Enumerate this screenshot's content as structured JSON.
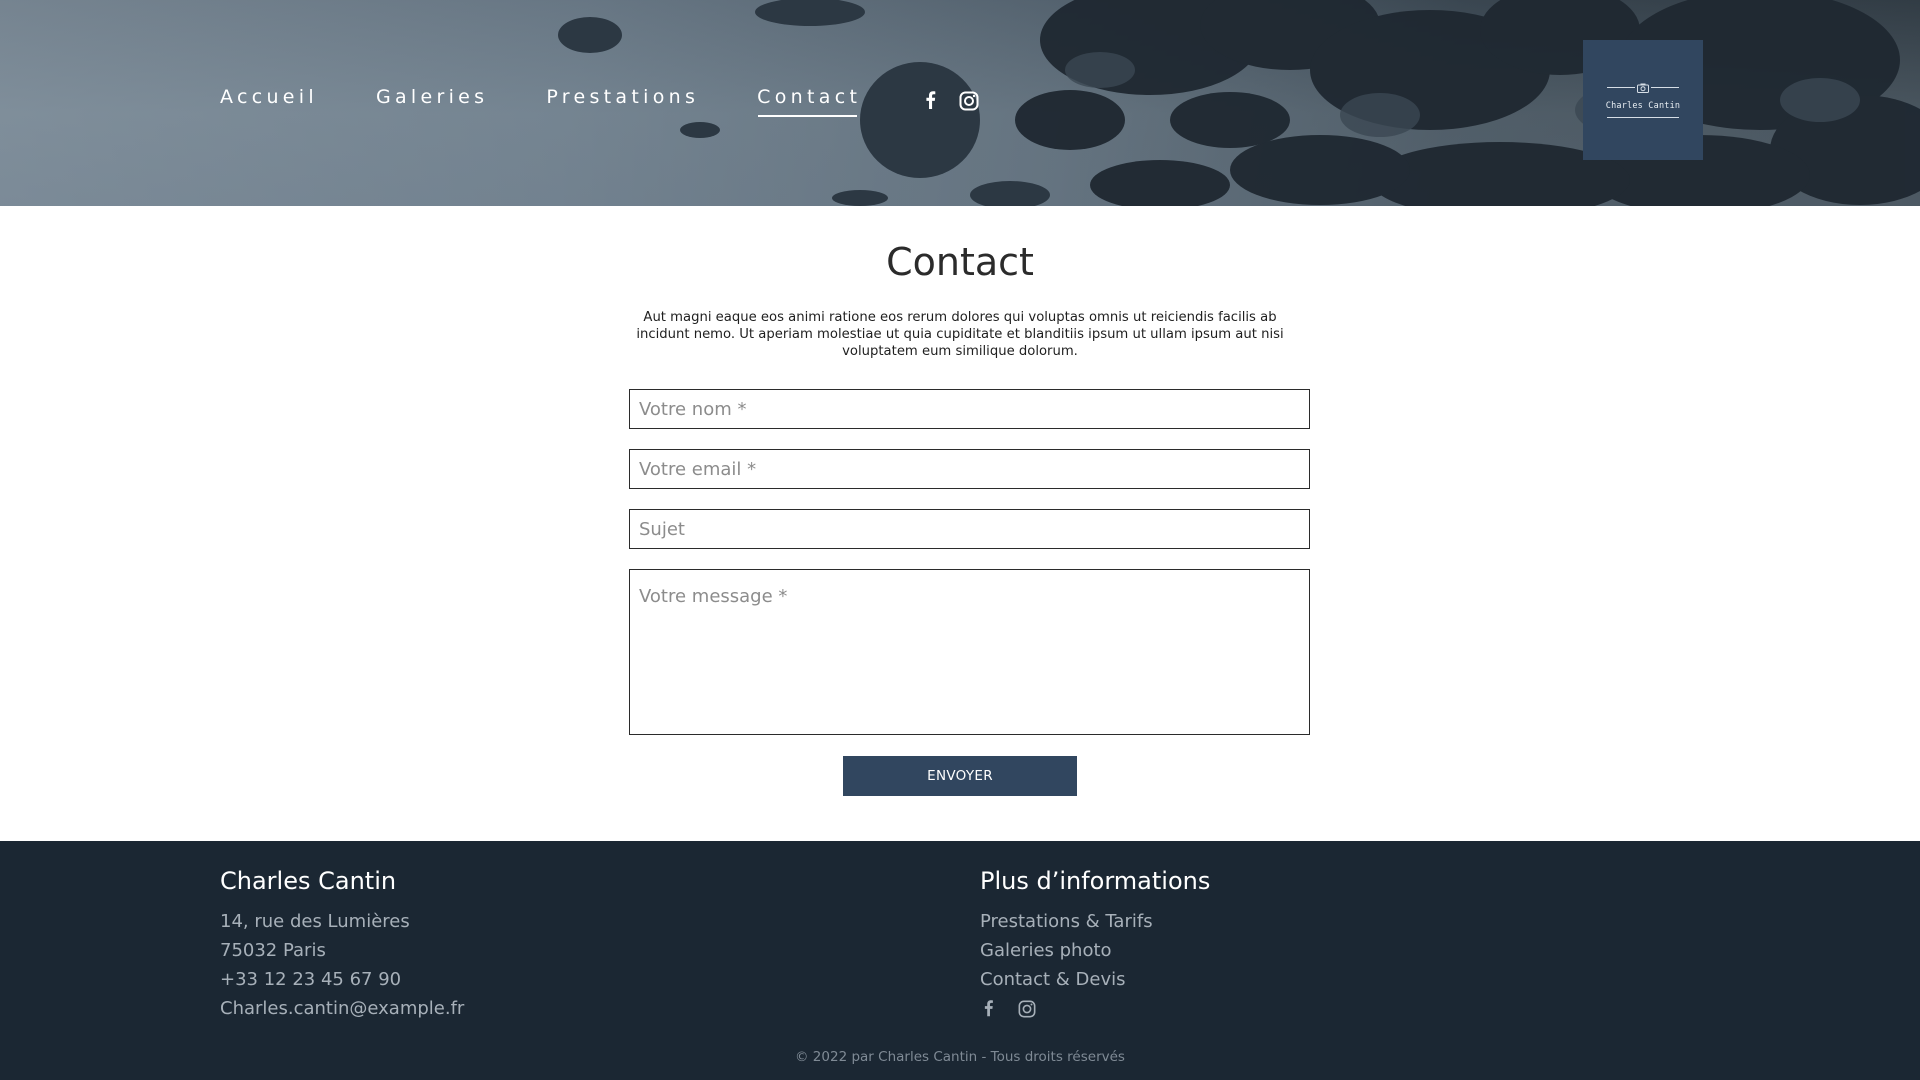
{
  "header": {
    "nav": [
      {
        "label": "Accueil",
        "active": false
      },
      {
        "label": "Galeries",
        "active": false
      },
      {
        "label": "Prestations",
        "active": false
      },
      {
        "label": "Contact",
        "active": true
      }
    ],
    "social": [
      "facebook-icon",
      "instagram-icon"
    ],
    "logo_text": "Charles Cantin",
    "logo_icon": "camera-icon"
  },
  "main": {
    "title": "Contact",
    "intro": "Aut magni eaque eos animi ratione eos rerum dolores qui voluptas omnis ut reiciendis facilis ab incidunt nemo. Ut aperiam molestiae ut quia cupiditate et blanditiis ipsum ut ullam ipsum aut nisi voluptatem eum similique dolorum.",
    "form": {
      "name_placeholder": "Votre nom *",
      "email_placeholder": "Votre email *",
      "subject_placeholder": "Sujet",
      "message_placeholder": "Votre message *",
      "submit_label": "ENVOYER"
    }
  },
  "footer": {
    "left": {
      "title": "Charles Cantin",
      "address_line1": "14, rue des Lumières",
      "address_line2": "75032 Paris",
      "phone": "+33 12 23 45 67 90",
      "email": "Charles.cantin@example.fr"
    },
    "right": {
      "title": "Plus d’informations",
      "links": [
        "Prestations & Tarifs",
        "Galeries photo",
        "Contact & Devis"
      ],
      "social": [
        "facebook-icon",
        "instagram-icon"
      ]
    },
    "copyright": "© 2022 par Charles Cantin - Tous droits réservés"
  },
  "colors": {
    "accent": "#31465f",
    "footer_bg": "#1b2733",
    "footer_text": "#a7b0b9"
  }
}
